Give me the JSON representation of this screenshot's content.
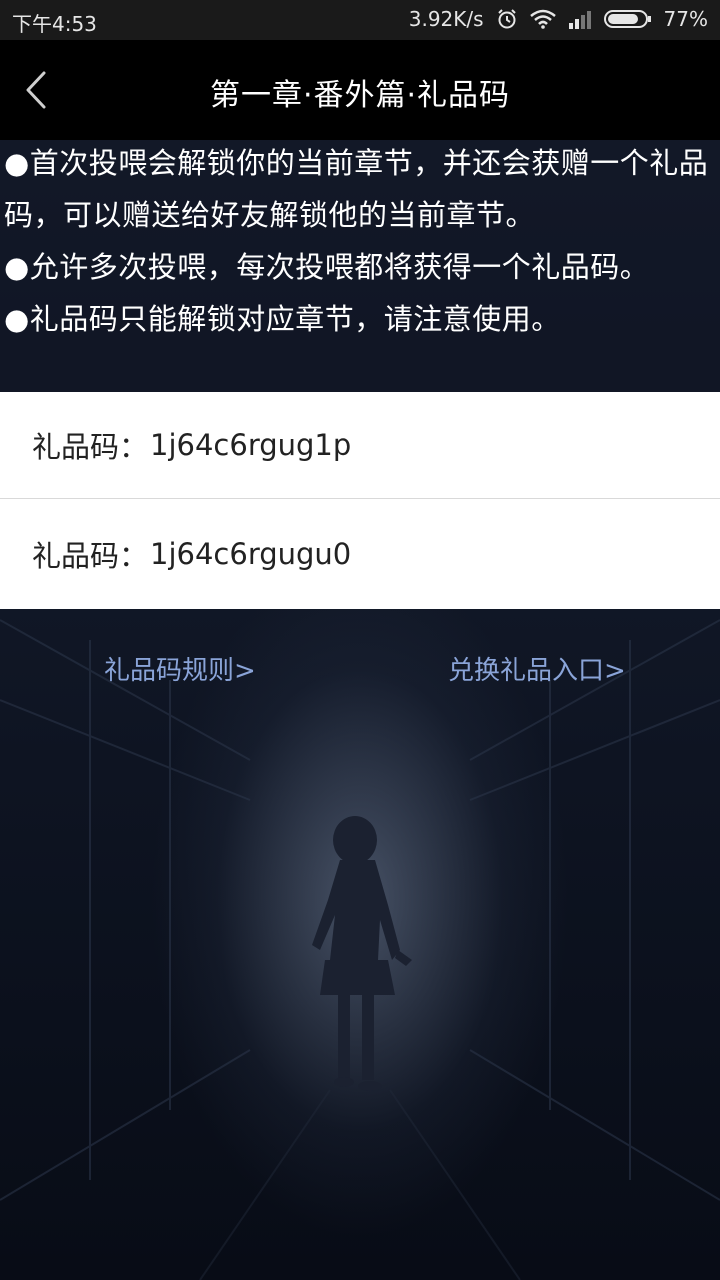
{
  "status_bar": {
    "time": "下午4:53",
    "network_speed": "3.92K/s",
    "battery": "77%",
    "icons": [
      "alarm-icon",
      "wifi-icon",
      "signal-icon",
      "battery-icon"
    ]
  },
  "nav": {
    "title": "第一章·番外篇·礼品码",
    "back_icon": "chevron-left-icon"
  },
  "rules": [
    "●首次投喂会解锁你的当前章节，并还会获赠一个礼品码，可以赠送给好友解锁他的当前章节。",
    "●允许多次投喂，每次投喂都将获得一个礼品码。",
    "●礼品码只能解锁对应章节，请注意使用。"
  ],
  "codes": [
    {
      "label": "礼品码：",
      "value": "1j64c6rgug1p"
    },
    {
      "label": "礼品码：",
      "value": "1j64c6rgugu0"
    }
  ],
  "links": {
    "rules_link": "礼品码规则>",
    "redeem_link": "兑换礼品入口>"
  },
  "colors": {
    "nav_bg": "#000000",
    "status_bg": "#1a1a1a",
    "link": "#8aa4d8",
    "page_bg": "#0a0f1c"
  }
}
